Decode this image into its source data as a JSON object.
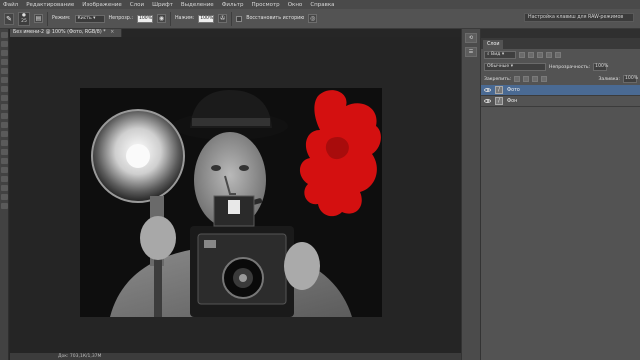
{
  "menubar": {
    "items": [
      "Файл",
      "Редактирование",
      "Изображение",
      "Слои",
      "Шрифт",
      "Выделение",
      "Фильтр",
      "Просмотр",
      "Окно",
      "Справка"
    ]
  },
  "options": {
    "tool_icon": "brush-icon",
    "brush_size": "25",
    "mode_label": "Режим:",
    "mode_value": "Кисть",
    "opacity_label": "Непрозр.:",
    "opacity_value": "100%",
    "flow_label": "Нажим:",
    "flow_value": "100%",
    "erase_to_history": "Восстановить историю",
    "workspace_preset": "Настройка клавиш для RAW-режимов"
  },
  "document": {
    "tab_title": "Без имени-2 @ 100% (Фото, RGB/8) *",
    "close_glyph": "×",
    "status": "Док: 703,1К/1,37М"
  },
  "right_dock": {
    "icons": [
      "history-icon",
      "properties-icon"
    ]
  },
  "layers_panel": {
    "tab_label": "Слои",
    "filter_label": "Вид",
    "blend_mode": "Обычные",
    "opacity_label": "Непрозрачность:",
    "opacity_value": "100%",
    "lock_label": "Закрепить:",
    "fill_label": "Заливка:",
    "fill_value": "100%",
    "layers": [
      {
        "name": "Фото",
        "selected": true
      },
      {
        "name": "Фон",
        "selected": false
      }
    ]
  },
  "colors": {
    "menubar": "#4a4a4a",
    "options_bar": "#535353",
    "canvas_bg": "#252525",
    "selected_layer": "#4a6a93",
    "accent_red": "#d41010"
  }
}
